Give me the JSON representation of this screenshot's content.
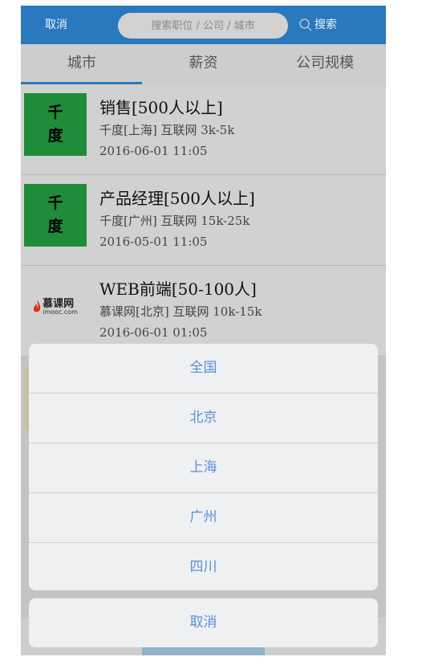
{
  "header": {
    "cancel_label": "取消",
    "search_placeholder": "搜索职位 / 公司 / 城市",
    "search_button_label": "搜索"
  },
  "tabs": [
    {
      "label": "城市",
      "active": true
    },
    {
      "label": "薪资",
      "active": false
    },
    {
      "label": "公司规模",
      "active": false
    }
  ],
  "jobs": [
    {
      "logo_chars": [
        "千",
        "度"
      ],
      "title": "销售[500人以上]",
      "meta": "千度[上海] 互联网 3k-5k",
      "date": "2016-06-01 11:05"
    },
    {
      "logo_chars": [
        "千",
        "度"
      ],
      "title": "产品经理[500人以上]",
      "meta": "千度[广州] 互联网 15k-25k",
      "date": "2016-05-01 11:05"
    },
    {
      "logo_text": "慕课网",
      "logo_subtext": "imooc.com",
      "title": "WEB前端[50-100人]",
      "meta": "慕课网[北京] 互联网 10k-15k",
      "date": "2016-06-01 01:05"
    }
  ],
  "action_sheet": {
    "options": [
      "全国",
      "北京",
      "上海",
      "广州",
      "四川"
    ],
    "cancel_label": "取消"
  },
  "colors": {
    "header_blue": "#2a78be",
    "logo_green": "#1f8c3a",
    "sheet_text": "#5a8fd8"
  }
}
